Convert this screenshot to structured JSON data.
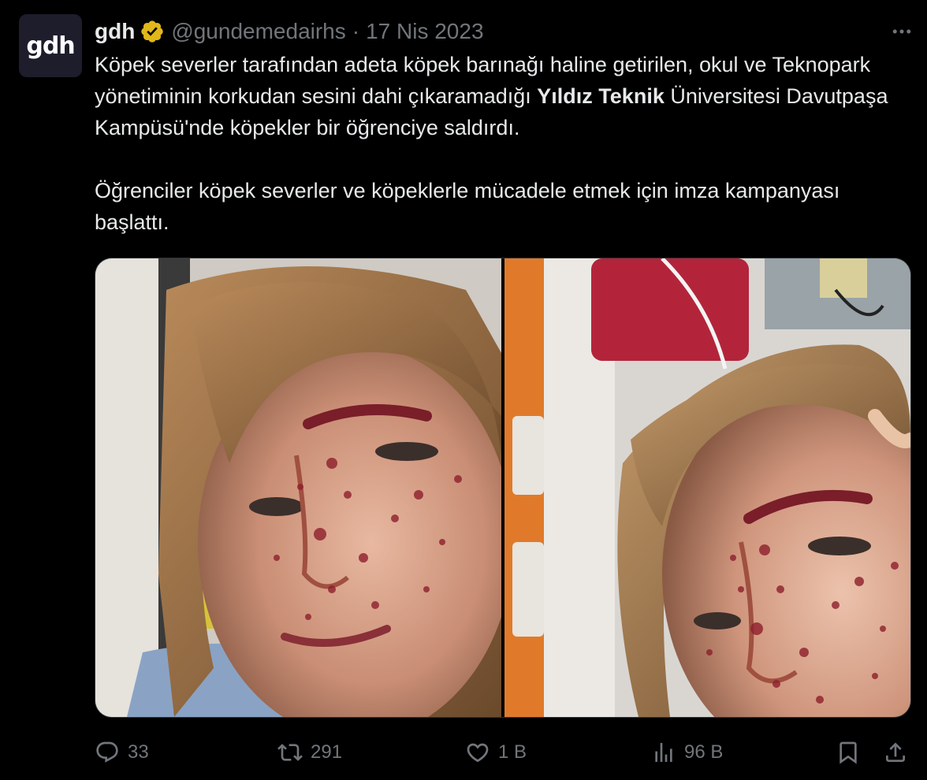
{
  "author": {
    "avatar_text": "gdh",
    "display_name": "gdh",
    "handle": "@gundemedairhs",
    "separator": "·",
    "date": "17 Nis 2023",
    "verified_badge_color": "#e2b719"
  },
  "more_icon": "…",
  "tweet": {
    "p1_before_bold": "Köpek severler tarafından adeta köpek barınağı haline getirilen, okul ve Teknopark yönetiminin korkudan sesini dahi çıkaramadığı ",
    "p1_bold": "Yıldız Teknik",
    "p1_after_bold": " Üniversitesi Davutpaşa Kampüsü'nde köpekler bir öğrenciye saldırdı.",
    "p2": "Öğrenciler köpek severler ve köpeklerle mücadele etmek için imza kampanyası başlattı."
  },
  "actions": {
    "reply_count": "33",
    "retweet_count": "291",
    "like_count": "1 B",
    "views_count": "96 B"
  },
  "colors": {
    "background": "#000000",
    "text": "#e7e9ea",
    "muted": "#71767b"
  }
}
